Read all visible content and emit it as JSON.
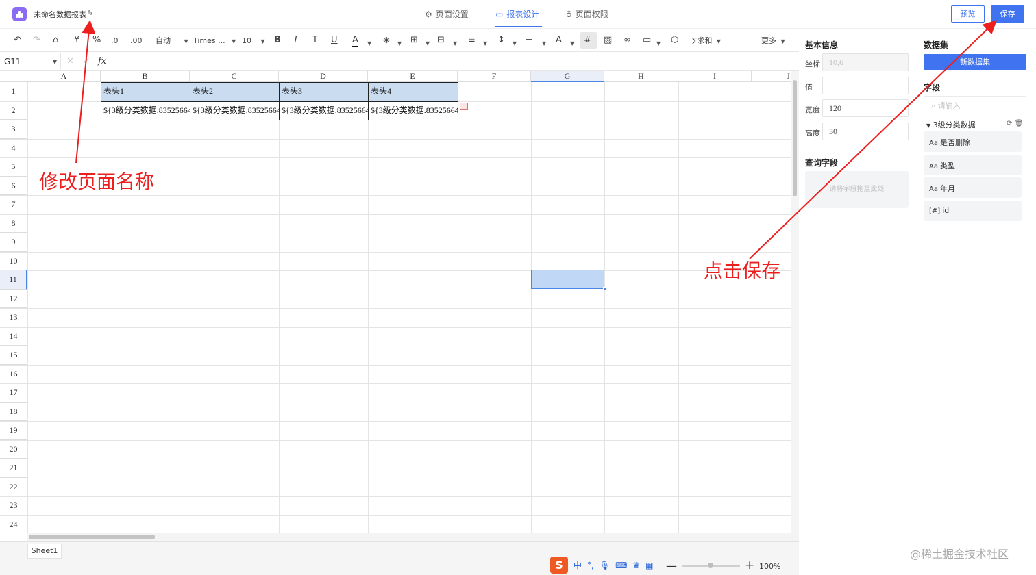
{
  "header": {
    "title": "未命名数据报表",
    "tabs": [
      {
        "label": "页面设置"
      },
      {
        "label": "报表设计"
      },
      {
        "label": "页面权限"
      }
    ],
    "preview_label": "预览",
    "save_label": "保存"
  },
  "toolbar": {
    "auto_label": "自动",
    "font_label": "Times ...",
    "size_label": "10",
    "sum_label": "求和",
    "more_label": "更多",
    "currency": "¥",
    "percent": "%"
  },
  "formula_bar": {
    "cell_ref": "G11",
    "fx": "fx"
  },
  "sheet": {
    "columns": [
      "A",
      "B",
      "C",
      "D",
      "E",
      "F",
      "G",
      "H",
      "I",
      "J"
    ],
    "rows": [
      "1",
      "2",
      "3",
      "4",
      "5",
      "6",
      "7",
      "8",
      "9",
      "10",
      "11",
      "12",
      "13",
      "14",
      "15",
      "16",
      "17",
      "18",
      "19",
      "20",
      "21",
      "22",
      "23",
      "24"
    ],
    "header_cells": [
      "表头1",
      "表头2",
      "表头3",
      "表头4"
    ],
    "data_cells": [
      "${3级分类数据.83525664",
      "${3级分类数据.83525664",
      "${3级分类数据.83525664",
      "${3级分类数据.83525664."
    ],
    "selected_cell": "G11"
  },
  "sheet_tabs": [
    "Sheet1"
  ],
  "status_bar": {
    "ime_chars": [
      "中",
      "°,"
    ],
    "zoom": "100%"
  },
  "basic_info": {
    "title": "基本信息",
    "coord_label": "坐标",
    "coord_value": "10,6",
    "value_label": "值",
    "value_value": "",
    "width_label": "宽度",
    "width_value": "120",
    "height_label": "高度",
    "height_value": "30"
  },
  "query_fields": {
    "title": "查询字段",
    "drop_hint": "请将字段拖至此处"
  },
  "dataset": {
    "title": "数据集",
    "new_button": "新数据集",
    "fields_title": "字段",
    "search_placeholder": "请输入",
    "group_name": "3级分类数据",
    "fields": [
      {
        "type": "Aa",
        "name": "是否删除"
      },
      {
        "type": "Aa",
        "name": "类型"
      },
      {
        "type": "Aa",
        "name": "年月"
      },
      {
        "type": "[#]",
        "name": "id"
      }
    ]
  },
  "annotations": {
    "rename_page": "修改页面名称",
    "click_save": "点击保存"
  },
  "watermark": "@稀土掘金技术社区",
  "colors": {
    "primary": "#3f73f0",
    "logo": "#8a6cf4",
    "header_fill": "#c9dcf0",
    "selection": "#c0d7f6",
    "annotation": "#ec1e1e"
  }
}
